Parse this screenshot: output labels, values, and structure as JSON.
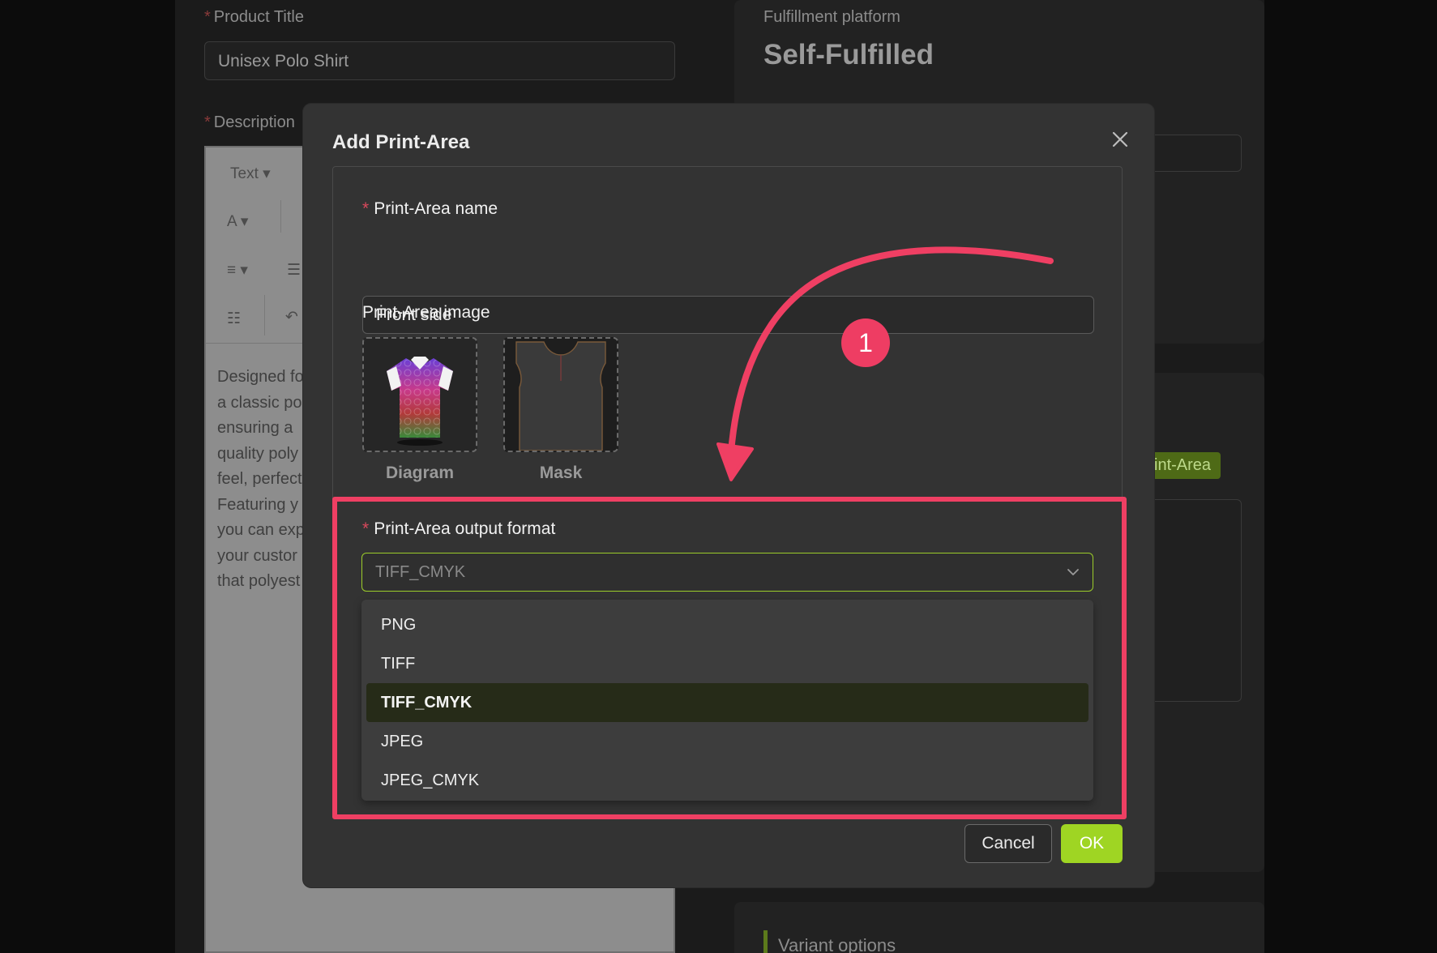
{
  "background": {
    "product_title": {
      "label": "Product Title",
      "value": "Unisex Polo Shirt"
    },
    "description": {
      "label": "Description",
      "toolbar": {
        "text_style": "Text ▾",
        "font_color": "A ▾",
        "align": "≡ ▾"
      },
      "text_lines": [
        "Designed fo",
        "a classic po",
        "ensuring a",
        "quality poly",
        "feel, perfect",
        "Featuring y",
        "you can exp",
        "your custor",
        "that polyest"
      ]
    },
    "fulfillment": {
      "label": "Fulfillment platform",
      "value": "Self-Fulfilled"
    },
    "print_area_button": "Print-Area",
    "variant_options": "Variant options"
  },
  "modal": {
    "title": "Add Print-Area",
    "close_icon": "close-icon",
    "print_area_name": {
      "label": "Print-Area name",
      "required": true,
      "value": "Front side"
    },
    "print_area_image": {
      "label": "Print-Area image",
      "items": [
        {
          "caption": "Diagram",
          "icon": "polo-shirt-diagram"
        },
        {
          "caption": "Mask",
          "icon": "polo-shirt-mask"
        }
      ]
    },
    "output_format": {
      "label": "Print-Area output format",
      "required": true,
      "selected": "TIFF_CMYK",
      "options": [
        "PNG",
        "TIFF",
        "TIFF_CMYK",
        "JPEG",
        "JPEG_CMYK"
      ]
    },
    "buttons": {
      "cancel": "Cancel",
      "ok": "OK"
    }
  },
  "annotation": {
    "step_number": "1",
    "color": "#ef3f63"
  },
  "colors": {
    "accent": "#9fd523",
    "required": "#d9485c",
    "highlight": "#ef3f63"
  }
}
